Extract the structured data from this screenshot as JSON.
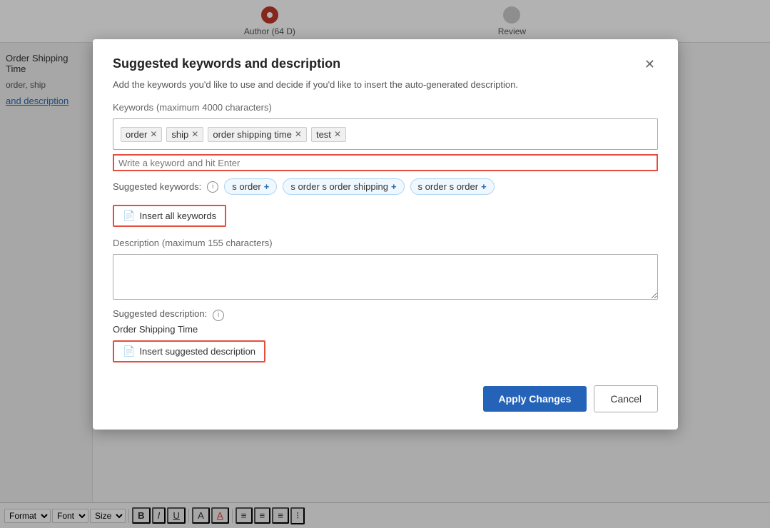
{
  "workflow": {
    "steps": [
      {
        "label": "Author (64 D)",
        "active": true
      },
      {
        "label": "Review",
        "active": false
      }
    ]
  },
  "sidebar": {
    "items": [
      {
        "text": "Order Shipping Time",
        "type": "heading"
      },
      {
        "text": "order, ship",
        "type": "meta"
      },
      {
        "text": "and description",
        "type": "link"
      }
    ]
  },
  "modal": {
    "title": "Suggested keywords and description",
    "subtitle": "Add the keywords you'd like to use and decide if you'd like to insert the auto-generated description.",
    "keywords_label": "Keywords",
    "keywords_max": "(maximum 4000 characters)",
    "tags": [
      {
        "label": "order"
      },
      {
        "label": "ship"
      },
      {
        "label": "order shipping time"
      },
      {
        "label": "test"
      }
    ],
    "keyword_input_placeholder": "Write a keyword and hit Enter",
    "suggested_keywords_label": "Suggested keywords:",
    "suggested_keywords": [
      {
        "label": "s order"
      },
      {
        "label": "s order s order shipping"
      },
      {
        "label": "s order s order"
      }
    ],
    "insert_all_label": "Insert all keywords",
    "description_label": "Description",
    "description_max": "(maximum 155 characters)",
    "description_value": "",
    "suggested_description_label": "Suggested description:",
    "suggested_description_text": "Order Shipping Time",
    "insert_suggested_label": "Insert suggested description",
    "apply_label": "Apply Changes",
    "cancel_label": "Cancel"
  },
  "toolbar": {
    "format_label": "Format",
    "font_label": "Font",
    "size_label": "Size",
    "bold": "B",
    "italic": "I",
    "underline": "U"
  }
}
